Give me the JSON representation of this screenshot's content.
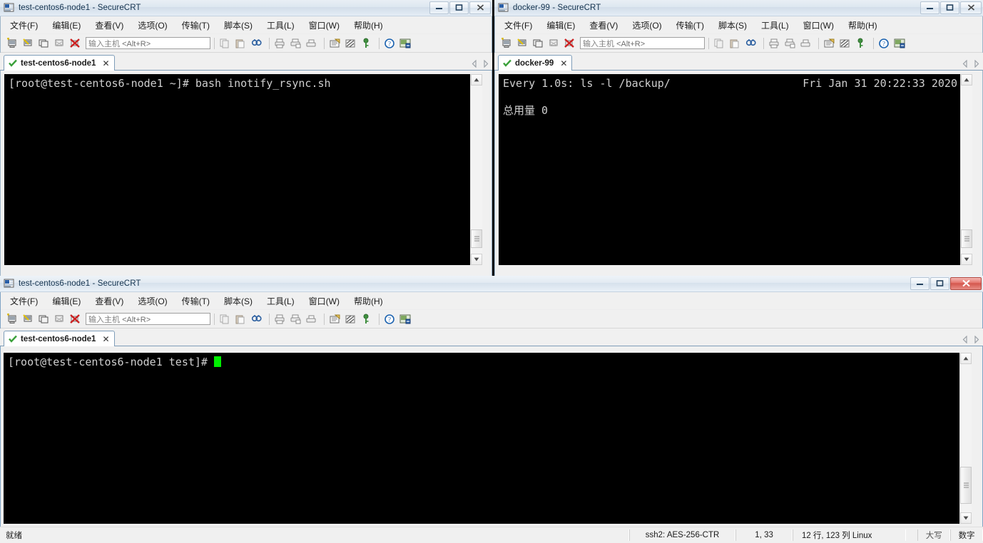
{
  "app": {
    "name": "SecureCRT"
  },
  "menu": {
    "items": [
      "文件(F)",
      "编辑(E)",
      "查看(V)",
      "选项(O)",
      "传输(T)",
      "脚本(S)",
      "工具(L)",
      "窗口(W)",
      "帮助(H)"
    ]
  },
  "toolbar": {
    "host_placeholder_label": "输入主机",
    "host_placeholder_hint": "<Alt+R>",
    "icons": [
      "new-session-icon",
      "connect-sftp-icon",
      "clone-session-icon",
      "connect-in-tab-icon",
      "disconnect-icon",
      "copy-icon",
      "paste-icon",
      "find-icon",
      "print-icon",
      "log-session-icon",
      "print-selection-icon",
      "properties-icon",
      "options-icon",
      "key-icon",
      "help-icon",
      "screen-capture-icon"
    ]
  },
  "windows": {
    "top_left": {
      "title": "test-centos6-node1 - SecureCRT",
      "active": false,
      "tab": {
        "label": "test-centos6-node1",
        "close": "✕",
        "connected": true
      },
      "terminal": {
        "lines": [
          "[root@test-centos6-node1 ~]# bash inotify_rsync.sh"
        ]
      }
    },
    "top_right": {
      "title": "docker-99 - SecureCRT",
      "active": false,
      "tab": {
        "label": "docker-99",
        "close": "✕",
        "connected": true
      },
      "terminal": {
        "watch_header_left": "Every 1.0s: ls -l /backup/",
        "watch_header_right": "Fri Jan 31 20:22:33 2020",
        "lines": [
          "总用量 0"
        ]
      }
    },
    "bottom": {
      "title": "test-centos6-node1 - SecureCRT",
      "active": true,
      "tab": {
        "label": "test-centos6-node1",
        "close": "✕",
        "connected": true
      },
      "terminal": {
        "prompt": "[root@test-centos6-node1 test]# ",
        "cursor": true
      },
      "statusbar": {
        "ready": "就绪",
        "cipher": "ssh2: AES-256-CTR",
        "position": "1, 33",
        "size": "12 行, 123 列 Linux",
        "caps": "大写",
        "num": "数字"
      }
    }
  },
  "buttons": {
    "minimize": "minimize-button",
    "maximize": "maximize-button",
    "close": "close-button"
  },
  "colors": {
    "terminal_bg": "#000000",
    "terminal_fg": "#cfcfcf",
    "cursor": "#00ee00",
    "close_red": "#d3544b",
    "chrome": "#f0f0f0"
  }
}
